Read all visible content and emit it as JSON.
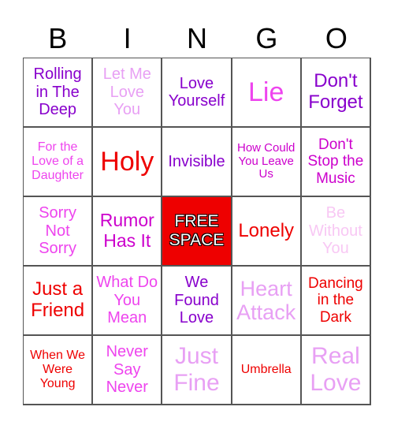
{
  "title_letters": [
    "B",
    "I",
    "N",
    "G",
    "O"
  ],
  "colors": {
    "purple": "#8800cc",
    "lavender": "#e8a0f4",
    "magenta": "#ee44ee",
    "dark_magenta": "#cc00cc",
    "red": "#ee0000",
    "pale_pink": "#f8c8f4",
    "free_bg": "#ee0000",
    "grid_line": "#555555"
  },
  "cells": [
    {
      "text": "Rolling in The Deep",
      "color": "purple",
      "size": 20
    },
    {
      "text": "Let Me Love You",
      "color": "lavender",
      "size": 20
    },
    {
      "text": "Love Yourself",
      "color": "purple",
      "size": 20
    },
    {
      "text": "Lie",
      "color": "magenta",
      "size": 34
    },
    {
      "text": "Don't Forget",
      "color": "purple",
      "size": 24
    },
    {
      "text": "For the Love of a Daughter",
      "color": "magenta",
      "size": 16
    },
    {
      "text": "Holy",
      "color": "red",
      "size": 34
    },
    {
      "text": "Invisible",
      "color": "purple",
      "size": 20
    },
    {
      "text": "How Could You Leave Us",
      "color": "dark_magenta",
      "size": 15
    },
    {
      "text": "Don't Stop the Music",
      "color": "dark_magenta",
      "size": 19
    },
    {
      "text": "Sorry Not Sorry",
      "color": "magenta",
      "size": 20
    },
    {
      "text": "Rumor Has It",
      "color": "dark_magenta",
      "size": 23
    },
    {
      "text": "FREE SPACE",
      "color": "free",
      "size": 21,
      "free": true
    },
    {
      "text": "Lonely",
      "color": "red",
      "size": 24
    },
    {
      "text": "Be Without You",
      "color": "pale_pink",
      "size": 20
    },
    {
      "text": "Just a Friend",
      "color": "red",
      "size": 24
    },
    {
      "text": "What Do You Mean",
      "color": "magenta",
      "size": 20
    },
    {
      "text": "We Found Love",
      "color": "purple",
      "size": 20
    },
    {
      "text": "Heart Attack",
      "color": "lavender",
      "size": 27
    },
    {
      "text": "Dancing in the Dark",
      "color": "red",
      "size": 19
    },
    {
      "text": "When We Were Young",
      "color": "red",
      "size": 16
    },
    {
      "text": "Never Say Never",
      "color": "magenta",
      "size": 20
    },
    {
      "text": "Just Fine",
      "color": "lavender",
      "size": 30
    },
    {
      "text": "Umbrella",
      "color": "red",
      "size": 16
    },
    {
      "text": "Real Love",
      "color": "lavender",
      "size": 30
    }
  ]
}
